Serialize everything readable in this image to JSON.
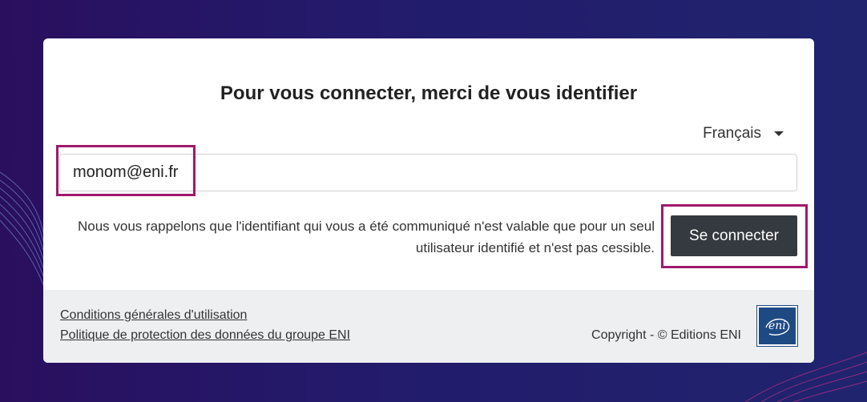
{
  "page": {
    "title": "Pour vous connecter, merci de vous identifier",
    "language": "Français"
  },
  "login": {
    "email_value": "monom@eni.fr",
    "notice": "Nous vous rappelons que l'identifiant qui vous a été communiqué n'est valable que pour un seul utilisateur identifié et n'est pas cessible.",
    "submit_label": "Se connecter"
  },
  "footer": {
    "links": [
      "Conditions générales d'utilisation",
      "Politique de protection des données du groupe ENI"
    ],
    "copyright": "Copyright - © Editions ENI",
    "logo_text": "eni"
  },
  "colors": {
    "background": "#231a6b",
    "highlight": "#a0196b",
    "button": "#343a40",
    "logo": "#1e4a84"
  }
}
